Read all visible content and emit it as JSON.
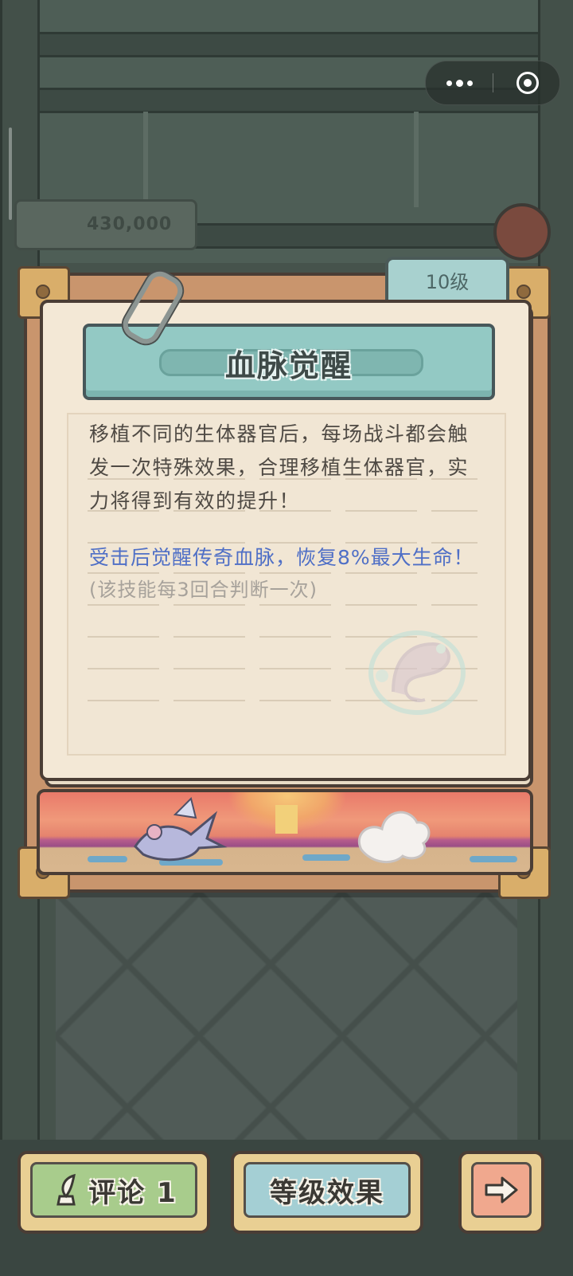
{
  "capsule": {
    "more_icon": "more-dots-icon",
    "close_icon": "target-circle-icon"
  },
  "background": {
    "score_plate": "430,000"
  },
  "card": {
    "level": "10级",
    "title": "血脉觉醒",
    "description": "移植不同的生体器官后，每场战斗都会触发一次特殊效果，合理移植生体器官，实力将得到有效的提升！",
    "effect": "受击后觉醒传奇血脉，恢复8%最大生命！",
    "note": "(该技能每3回合判断一次)",
    "accent_color": "#4f6fc6"
  },
  "buttons": {
    "comment_label": "评论 1",
    "level_label": "等级效果",
    "next_icon": "arrow-right-icon"
  }
}
